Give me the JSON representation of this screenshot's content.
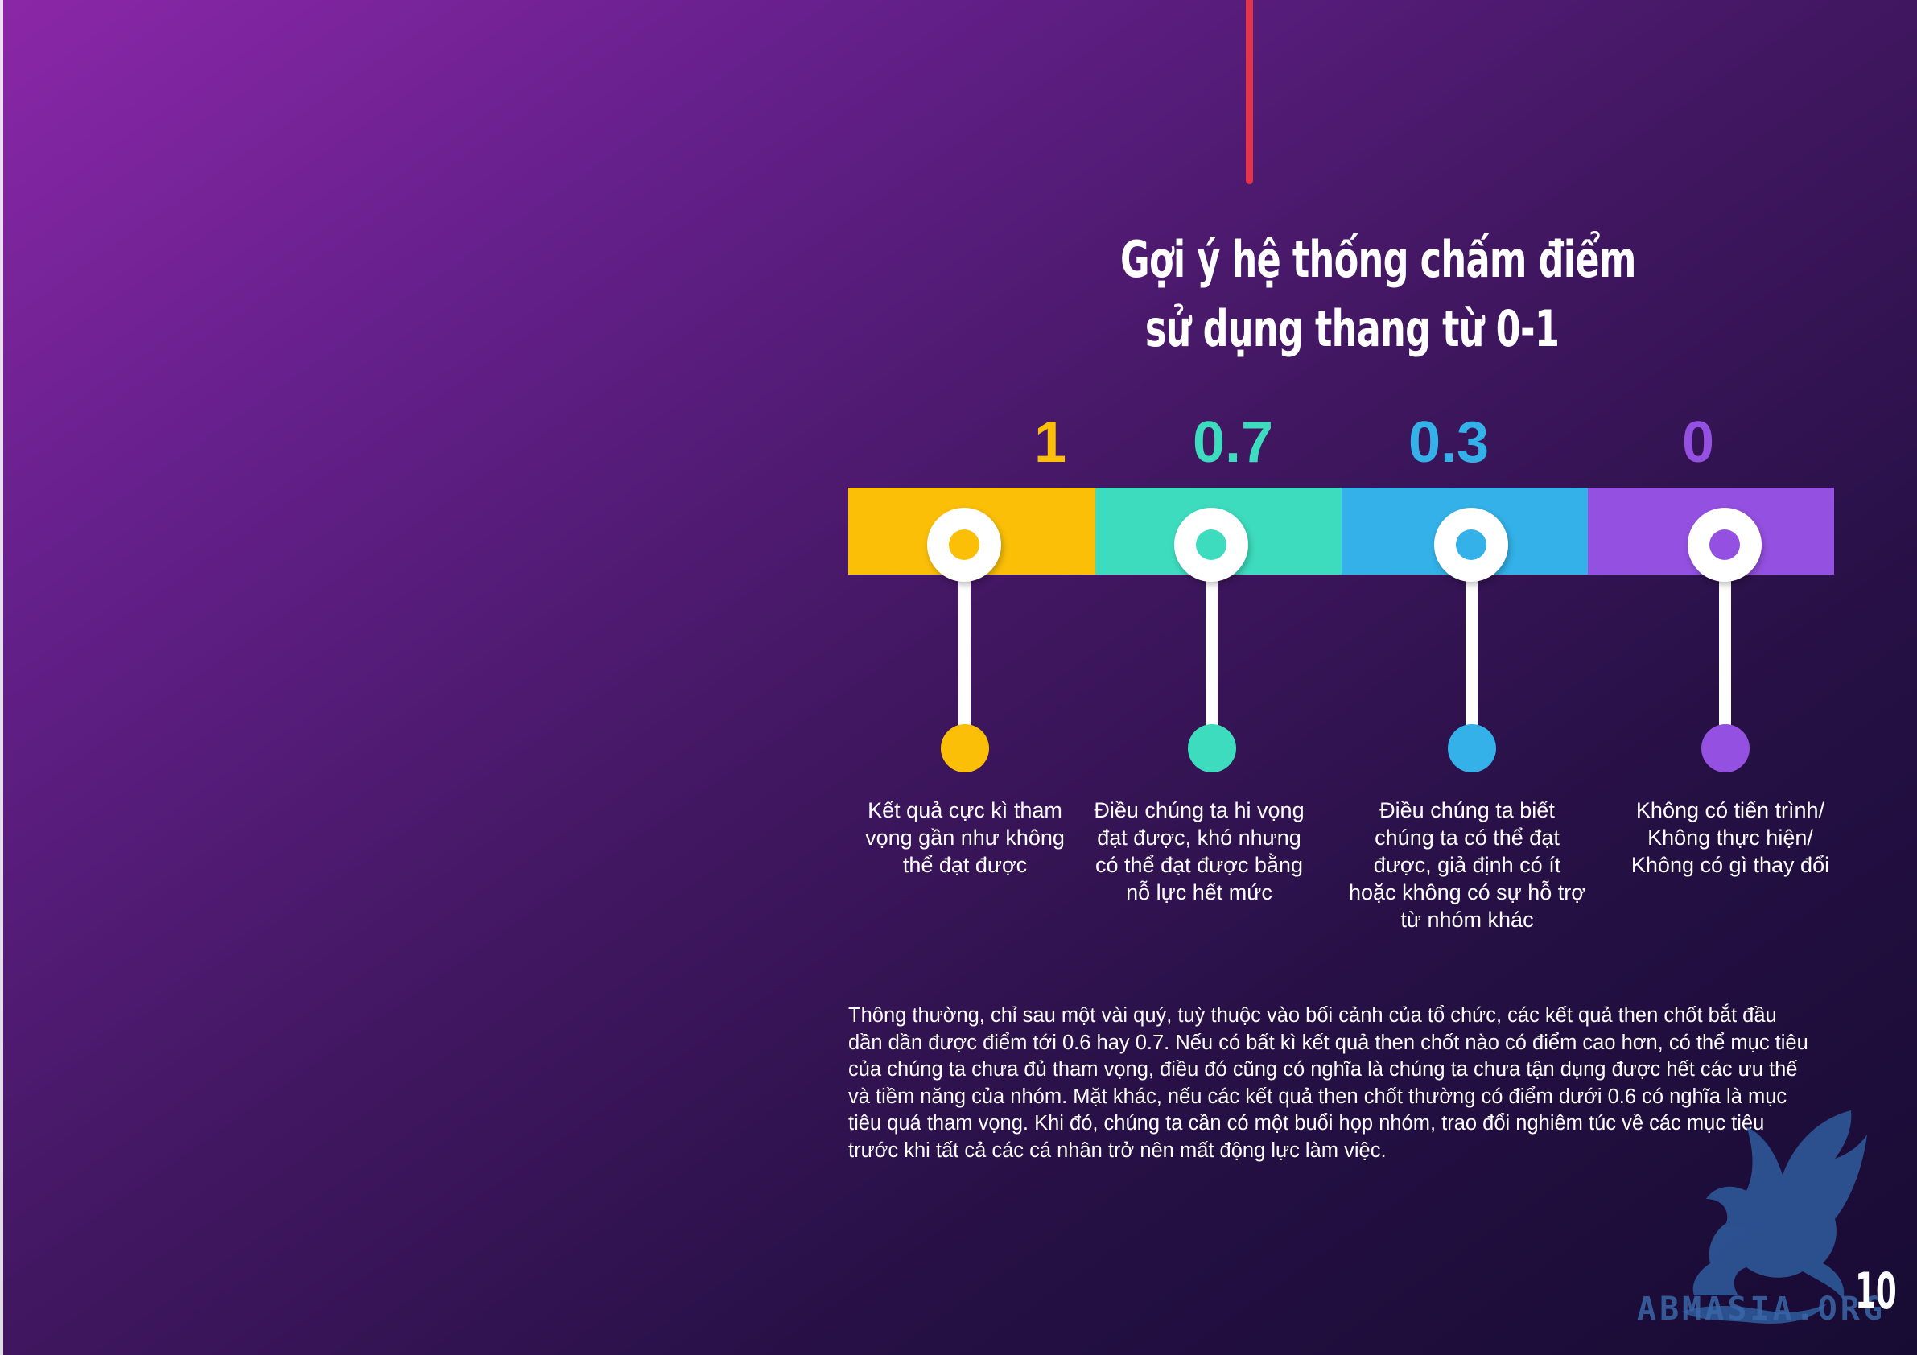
{
  "title": {
    "line1": "Gợi ý hệ thống chấm điểm",
    "line2": "sử dụng thang từ 0-1"
  },
  "scale": [
    {
      "value": "1",
      "color": "#fbbf08",
      "description": "Kết quả cực kì tham\nvọng gần như không\nthể đạt được"
    },
    {
      "value": "0.7",
      "color": "#3ddcbe",
      "description": "Điều chúng ta hi vọng\nđạt được, khó nhưng\ncó thể đạt được bằng\nnỗ lực hết mức"
    },
    {
      "value": "0.3",
      "color": "#33b1e8",
      "description": "Điều chúng ta biết\nchúng ta có thể đạt\nđược, giả định có ít\nhoặc không có sự hỗ trợ\ntừ nhóm khác"
    },
    {
      "value": "0",
      "color": "#9450e0",
      "description": "Không có tiến trình/\nKhông thực hiện/\nKhông có gì thay đổi"
    }
  ],
  "body_text": "Thông thường, chỉ sau một vài quý, tuỳ thuộc vào bối cảnh của tổ chức, các kết quả then chốt bắt đầu\ndần dần được điểm tới 0.6 hay 0.7. Nếu có bất kì kết quả then chốt nào có điểm cao hơn, có thể mục tiêu\ncủa chúng ta chưa đủ tham vọng, điều đó cũng có nghĩa là chúng ta chưa tận dụng được hết các ưu thế\nvà tiềm năng của nhóm. Mặt khác, nếu các kết quả then chốt thường có điểm dưới 0.6 có nghĩa là mục\ntiêu quá tham vọng. Khi đó, chúng ta cần có một buổi họp nhóm, trao đổi nghiêm túc về các mục tiêu\ntrước khi tất cả các cá nhân trở nên mất động lực làm việc.",
  "watermark": "ABMASIA.ORG",
  "page_number": "10",
  "colors": {
    "accent_line": "#e2354a",
    "background_start": "#8b27a8",
    "background_end": "#170b33"
  }
}
